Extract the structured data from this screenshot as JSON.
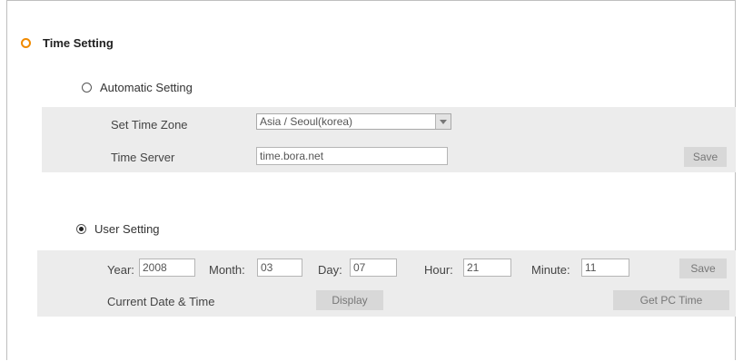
{
  "section": {
    "title": "Time Setting"
  },
  "automatic": {
    "label": "Automatic Setting",
    "timezone_label": "Set Time Zone",
    "timezone_value": "Asia / Seoul(korea)",
    "server_label": "Time Server",
    "server_value": "time.bora.net",
    "save_label": "Save"
  },
  "user": {
    "label": "User Setting",
    "year_label": "Year:",
    "year_value": "2008",
    "month_label": "Month:",
    "month_value": "03",
    "day_label": "Day:",
    "day_value": "07",
    "hour_label": "Hour:",
    "hour_value": "21",
    "minute_label": "Minute:",
    "minute_value": "11",
    "save_label": "Save",
    "current_label": "Current Date & Time",
    "display_label": "Display",
    "pc_time_label": "Get PC Time"
  },
  "colors": {
    "accent": "#f08a00",
    "panel": "#ececec",
    "button": "#d8d8d8"
  }
}
